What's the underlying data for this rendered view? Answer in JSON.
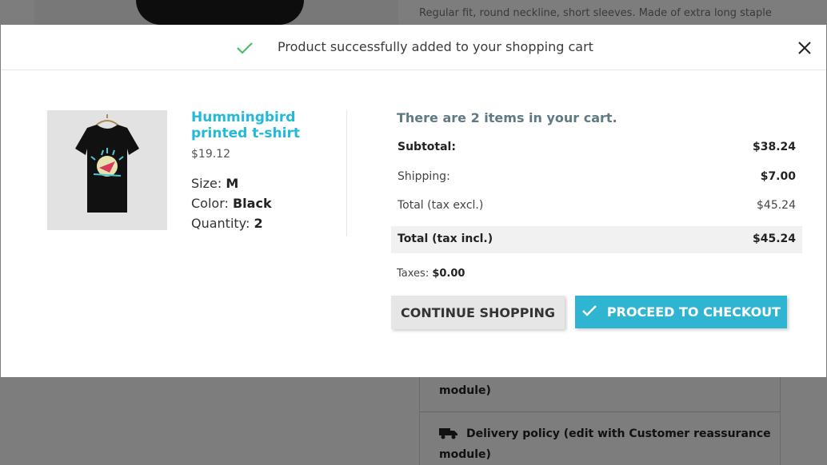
{
  "background": {
    "description_snippet": "Regular fit, round neckline, short sleeves. Made of extra long staple",
    "reassurance_item_1": "module)",
    "reassurance_item_2_line1": "Delivery policy (edit with Customer reassurance",
    "reassurance_item_2_line2": "module)"
  },
  "modal": {
    "header_text": "Product successfully added to your shopping cart",
    "product": {
      "name": "Hummingbird printed t-shirt",
      "price": "$19.12",
      "size_label": "Size:",
      "size_value": "M",
      "color_label": "Color:",
      "color_value": "Black",
      "quantity_label": "Quantity:",
      "quantity_value": "2"
    },
    "cart": {
      "count_text": "There are 2 items in your cart.",
      "subtotal_label": "Subtotal:",
      "subtotal_value": "$38.24",
      "shipping_label": "Shipping:",
      "shipping_value": "$7.00",
      "total_excl_label": "Total (tax excl.)",
      "total_excl_value": "$45.24",
      "total_incl_label": "Total (tax incl.)",
      "total_incl_value": "$45.24",
      "taxes_label": "Taxes:",
      "taxes_value": "$0.00"
    },
    "buttons": {
      "continue": "CONTINUE SHOPPING",
      "checkout": "PROCEED TO CHECKOUT"
    }
  },
  "colors": {
    "accent": "#2fb5d2",
    "product_name": "#24b9d7",
    "success_check": "#4cbb6c"
  },
  "icons": [
    "check-icon",
    "close-icon",
    "truck-icon"
  ]
}
